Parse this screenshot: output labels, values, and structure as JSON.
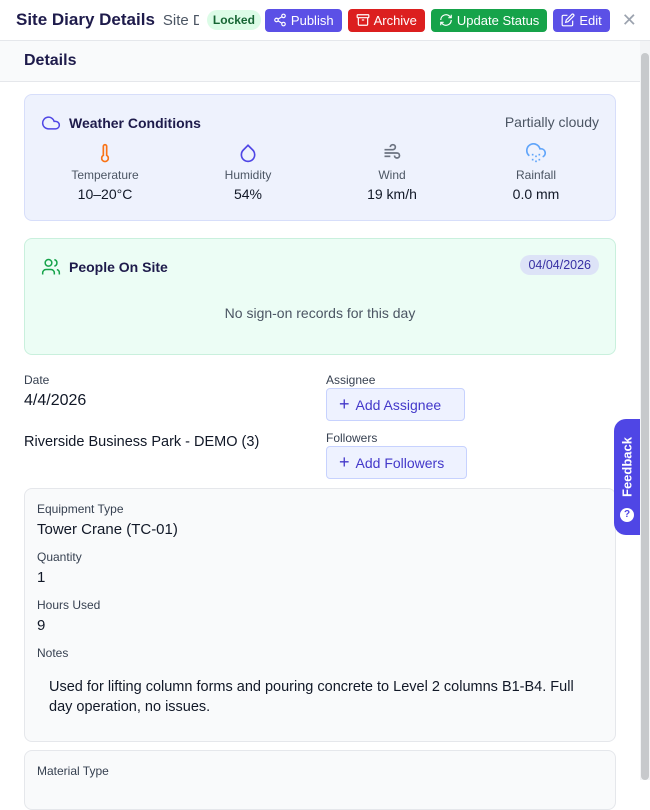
{
  "header": {
    "title": "Site Diary Details",
    "subtitle": "Site Diary",
    "status_badge": "Locked",
    "publish_label": "Publish",
    "archive_label": "Archive",
    "update_status_label": "Update Status",
    "edit_label": "Edit",
    "close_glyph": "✕"
  },
  "section_title": "Details",
  "weather": {
    "title": "Weather Conditions",
    "description": "Partially cloudy",
    "metrics": [
      {
        "label": "Temperature",
        "value": "10–20°C",
        "icon": "thermometer-icon"
      },
      {
        "label": "Humidity",
        "value": "54%",
        "icon": "droplet-icon"
      },
      {
        "label": "Wind",
        "value": "19 km/h",
        "icon": "wind-icon"
      },
      {
        "label": "Rainfall",
        "value": "0.0 mm",
        "icon": "cloud-rain-icon"
      }
    ]
  },
  "people": {
    "title": "People On Site",
    "date": "04/04/2026",
    "empty_message": "No sign-on records for this day"
  },
  "fields": {
    "date_label": "Date",
    "date_value": "4/4/2026",
    "project_value": "Riverside Business Park - DEMO (3)",
    "assignee_label": "Assignee",
    "add_assignee_label": "Add Assignee",
    "followers_label": "Followers",
    "add_followers_label": "Add Followers"
  },
  "equipment": {
    "type_label": "Equipment Type",
    "type_value": "Tower Crane (TC-01)",
    "quantity_label": "Quantity",
    "quantity_value": "1",
    "hours_label": "Hours Used",
    "hours_value": "9",
    "notes_label": "Notes",
    "notes_value": "Used for lifting column forms and pouring concrete to Level 2 columns B1-B4. Full day operation, no issues."
  },
  "material": {
    "type_label": "Material Type"
  },
  "feedback": {
    "label": "Feedback",
    "icon_glyph": "?"
  },
  "colors": {
    "primary": "#5b50e6",
    "danger": "#dc1f1f",
    "success": "#16a34a",
    "title": "#1e1b4b"
  }
}
